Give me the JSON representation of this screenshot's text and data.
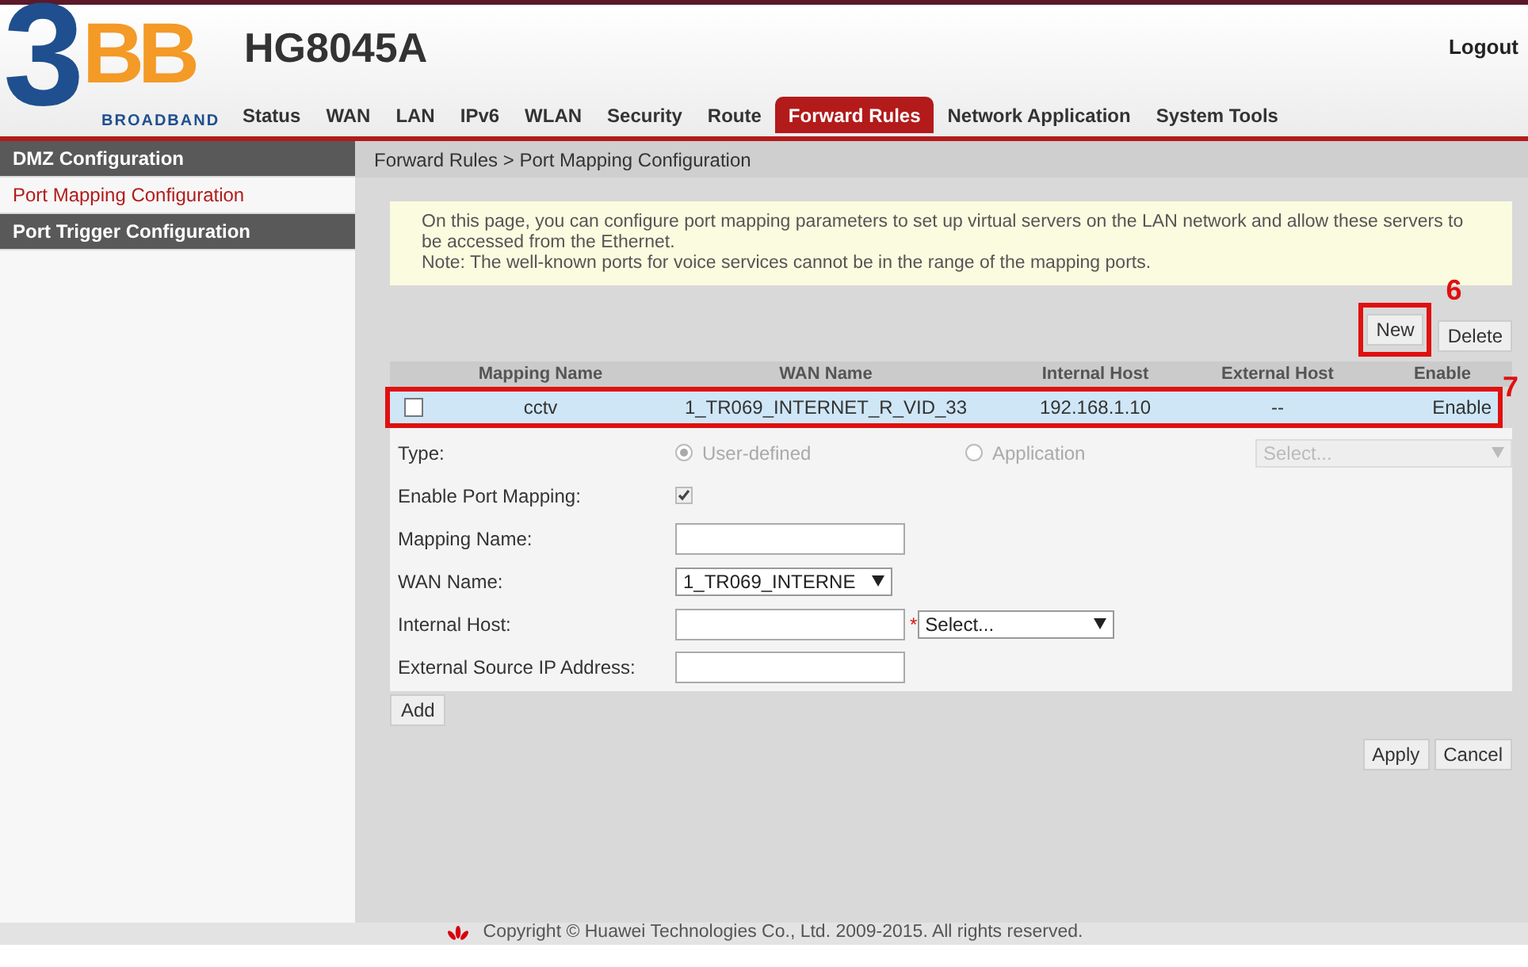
{
  "logo": {
    "digit": "3",
    "letters": "BB",
    "tagline": "BROADBAND"
  },
  "model": "HG8045A",
  "logout": "Logout",
  "nav": [
    {
      "label": "Status",
      "selected": false
    },
    {
      "label": "WAN",
      "selected": false
    },
    {
      "label": "LAN",
      "selected": false
    },
    {
      "label": "IPv6",
      "selected": false
    },
    {
      "label": "WLAN",
      "selected": false
    },
    {
      "label": "Security",
      "selected": false
    },
    {
      "label": "Route",
      "selected": false
    },
    {
      "label": "Forward Rules",
      "selected": true
    },
    {
      "label": "Network Application",
      "selected": false
    },
    {
      "label": "System Tools",
      "selected": false
    }
  ],
  "sidebar": {
    "items": [
      {
        "label": "DMZ Configuration",
        "selected": false
      },
      {
        "label": "Port Mapping Configuration",
        "selected": true
      },
      {
        "label": "Port Trigger Configuration",
        "selected": false
      }
    ]
  },
  "breadcrumb": "Forward Rules > Port Mapping Configuration",
  "note": [
    "On this page, you can configure port mapping parameters to set up virtual servers on the LAN network and allow these servers to be accessed from the Ethernet.",
    "Note: The well-known ports for voice services cannot be in the range of the mapping ports."
  ],
  "table_buttons": [
    "New",
    "Delete"
  ],
  "table": {
    "columns": [
      "Mapping Name",
      "WAN Name",
      "Internal Host",
      "External Host",
      "Enable"
    ],
    "rows": [
      {
        "checked": false,
        "selected": true,
        "cells": [
          "cctv",
          "1_TR069_INTERNET_R_VID_33",
          "192.168.1.10",
          "--",
          "Enable"
        ]
      }
    ]
  },
  "form": [
    {
      "kind": "radio",
      "label": "Type:",
      "options": [
        {
          "label": "User-defined",
          "selected": true
        },
        {
          "label": "Application",
          "selected": false
        }
      ],
      "select": "Select...",
      "disabled": true
    },
    {
      "kind": "checkbox",
      "label": "Enable Port Mapping:",
      "checked": true
    },
    {
      "kind": "text",
      "label": "Mapping Name:"
    },
    {
      "kind": "select",
      "label": "WAN Name:",
      "value": "1_TR069_INTERNE"
    },
    {
      "kind": "text_select",
      "label": "Internal Host:",
      "required": "*",
      "select": "Select..."
    },
    {
      "kind": "text",
      "label": "External Source IP Address:"
    }
  ],
  "add_button": "Add",
  "actions": [
    "Apply",
    "Cancel"
  ],
  "annotations": [
    {
      "label": "6"
    },
    {
      "label": "7"
    }
  ],
  "footer": "Copyright © Huawei Technologies Co., Ltd. 2009-2015. All rights reserved."
}
